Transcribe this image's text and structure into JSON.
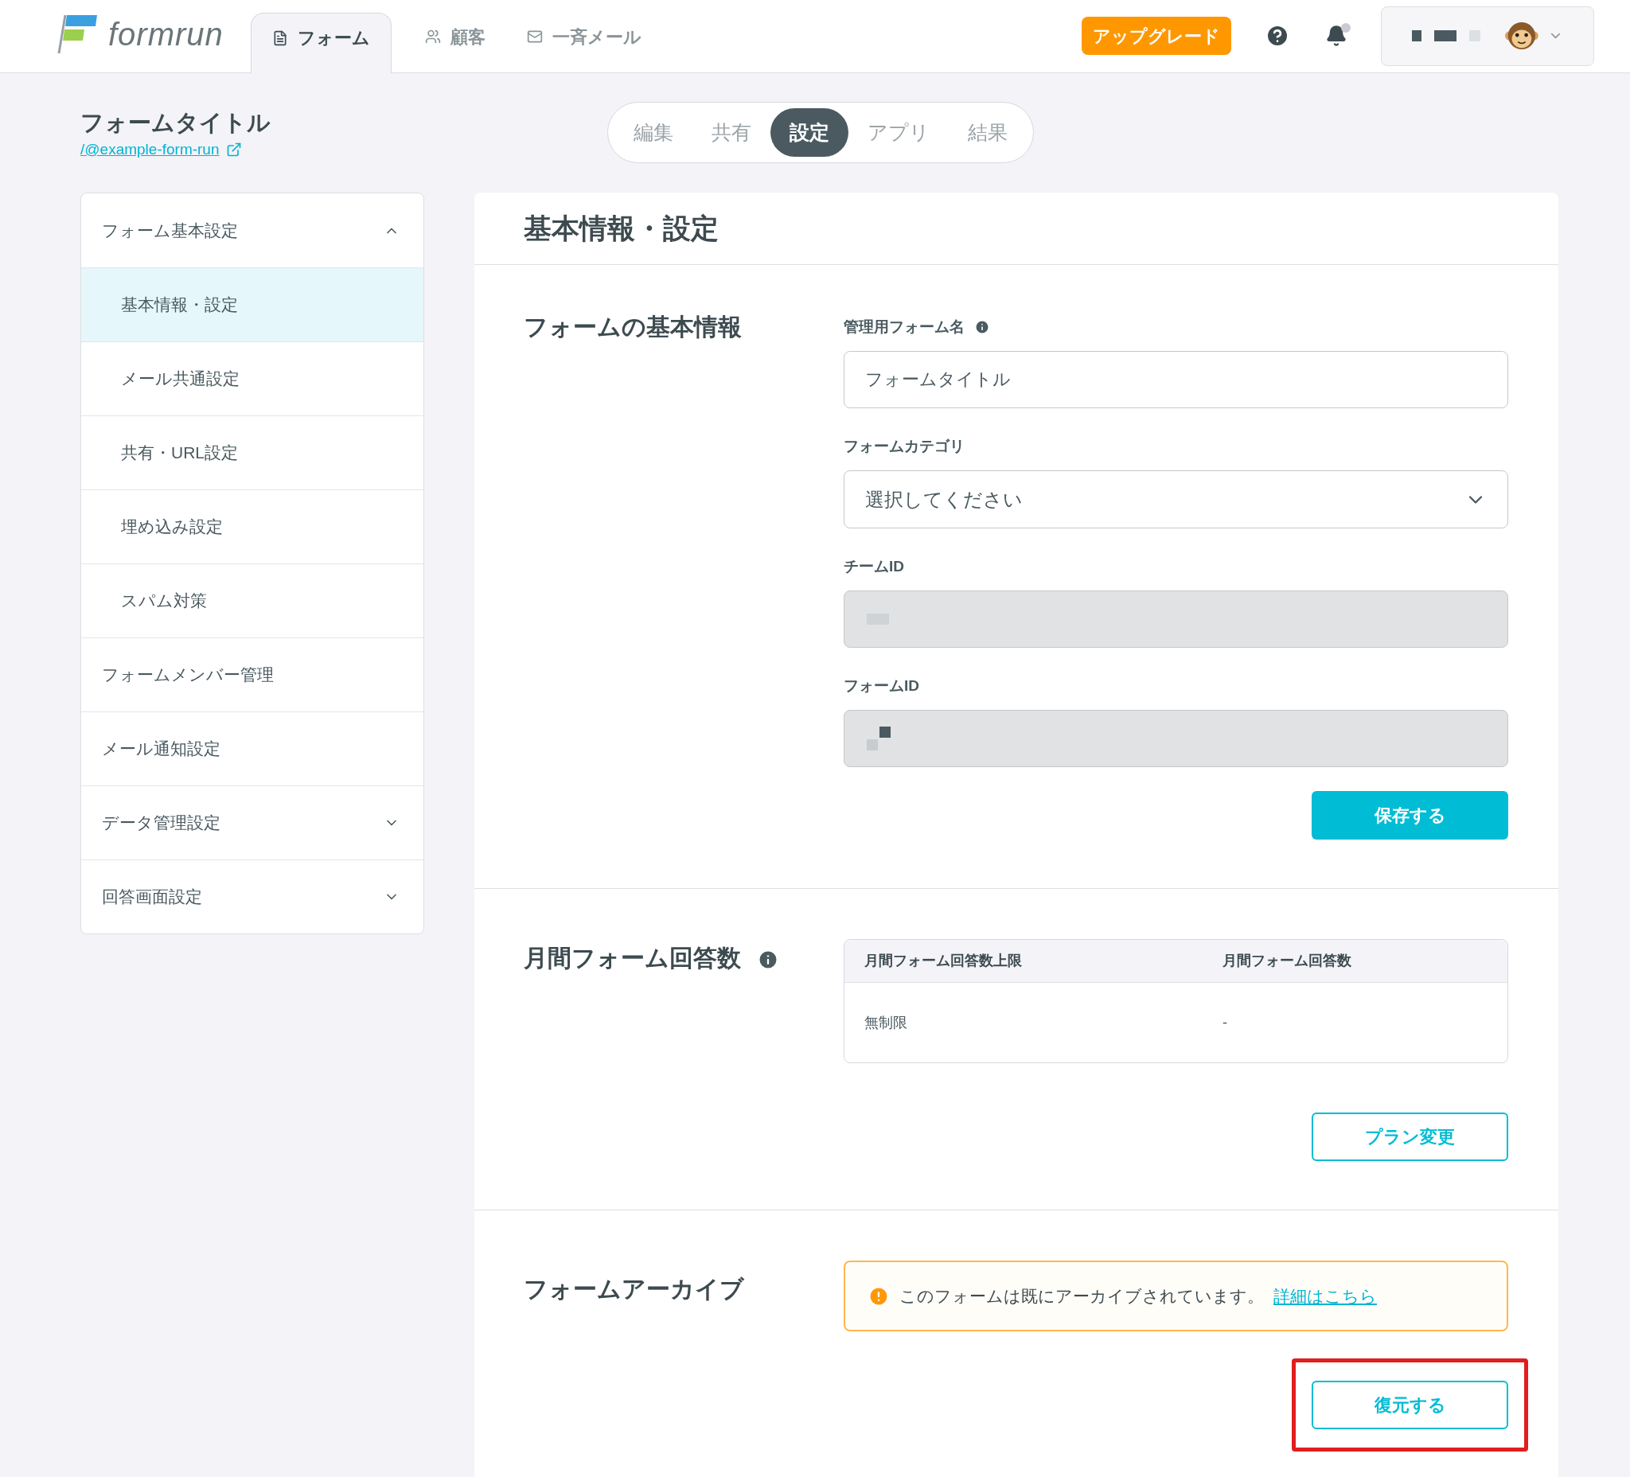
{
  "header": {
    "logo": "formrun",
    "nav": [
      {
        "label": "フォーム",
        "selected": true
      },
      {
        "label": "顧客",
        "selected": false
      },
      {
        "label": "一斉メール",
        "selected": false
      }
    ],
    "upgrade": "アップグレード"
  },
  "form": {
    "title": "フォームタイトル",
    "link": "/@example-form-run"
  },
  "segments": [
    {
      "label": "編集",
      "selected": false
    },
    {
      "label": "共有",
      "selected": false
    },
    {
      "label": "設定",
      "selected": true
    },
    {
      "label": "アプリ",
      "selected": false
    },
    {
      "label": "結果",
      "selected": false
    }
  ],
  "sidebar": {
    "items": [
      {
        "label": "フォーム基本設定",
        "kind": "group",
        "expanded": true,
        "children": [
          {
            "label": "基本情報・設定",
            "selected": true
          },
          {
            "label": "メール共通設定",
            "selected": false
          },
          {
            "label": "共有・URL設定",
            "selected": false
          },
          {
            "label": "埋め込み設定",
            "selected": false
          },
          {
            "label": "スパム対策",
            "selected": false
          }
        ]
      },
      {
        "label": "フォームメンバー管理",
        "kind": "link"
      },
      {
        "label": "メール通知設定",
        "kind": "link"
      },
      {
        "label": "データ管理設定",
        "kind": "group",
        "expanded": false
      },
      {
        "label": "回答画面設定",
        "kind": "group",
        "expanded": false
      }
    ]
  },
  "page_title": "基本情報・設定",
  "basic": {
    "title": "フォームの基本情報",
    "fields": [
      {
        "label": "管理用フォーム名",
        "kind": "text",
        "value": "フォームタイトル",
        "info": true
      },
      {
        "label": "フォームカテゴリ",
        "kind": "select",
        "value": "選択してください",
        "info": false
      },
      {
        "label": "チームID",
        "kind": "readonly",
        "info": false
      },
      {
        "label": "フォームID",
        "kind": "readonly",
        "info": false
      }
    ],
    "save": "保存する"
  },
  "responses": {
    "title": "月間フォーム回答数",
    "columns": [
      "月間フォーム回答数上限",
      "月間フォーム回答数"
    ],
    "rows": [
      [
        "無制限",
        "-"
      ]
    ],
    "button": "プラン変更"
  },
  "archive": {
    "title": "フォームアーカイブ",
    "message": "このフォームは既にアーカイブされています。",
    "link": "詳細はこちら",
    "button": "復元する"
  }
}
